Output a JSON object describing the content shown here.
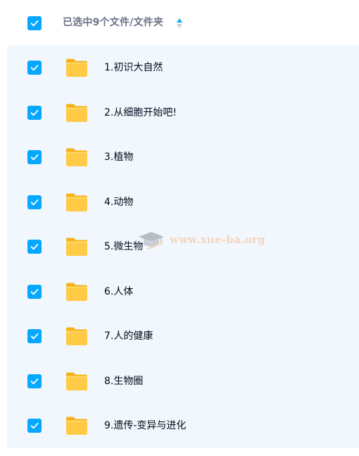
{
  "header": {
    "title": "已选中9个文件/文件夹",
    "select_all_checked": true
  },
  "files": [
    {
      "name": "1.初识大自然",
      "type": "folder",
      "checked": true
    },
    {
      "name": "2.从细胞开始吧!",
      "type": "folder",
      "checked": true
    },
    {
      "name": "3.植物",
      "type": "folder",
      "checked": true
    },
    {
      "name": "4.动物",
      "type": "folder",
      "checked": true
    },
    {
      "name": "5.微生物",
      "type": "folder",
      "checked": true
    },
    {
      "name": "6.人体",
      "type": "folder",
      "checked": true
    },
    {
      "name": "7.人的健康",
      "type": "folder",
      "checked": true
    },
    {
      "name": "8.生物圈",
      "type": "folder",
      "checked": true
    },
    {
      "name": "9.遗传-变异与进化",
      "type": "folder",
      "checked": true
    }
  ],
  "watermark": {
    "text": "www.xue-ba.org",
    "icon": "graduation-cap-icon"
  },
  "icons": {
    "checkbox": "checkmark-icon",
    "folder": "folder-icon",
    "sort": "sort-icon"
  },
  "colors": {
    "accent": "#06a7ff",
    "row_background": "#f2f7fd",
    "folder": "#ffc947",
    "header_text": "#6b7186",
    "row_text": "#03081a"
  }
}
